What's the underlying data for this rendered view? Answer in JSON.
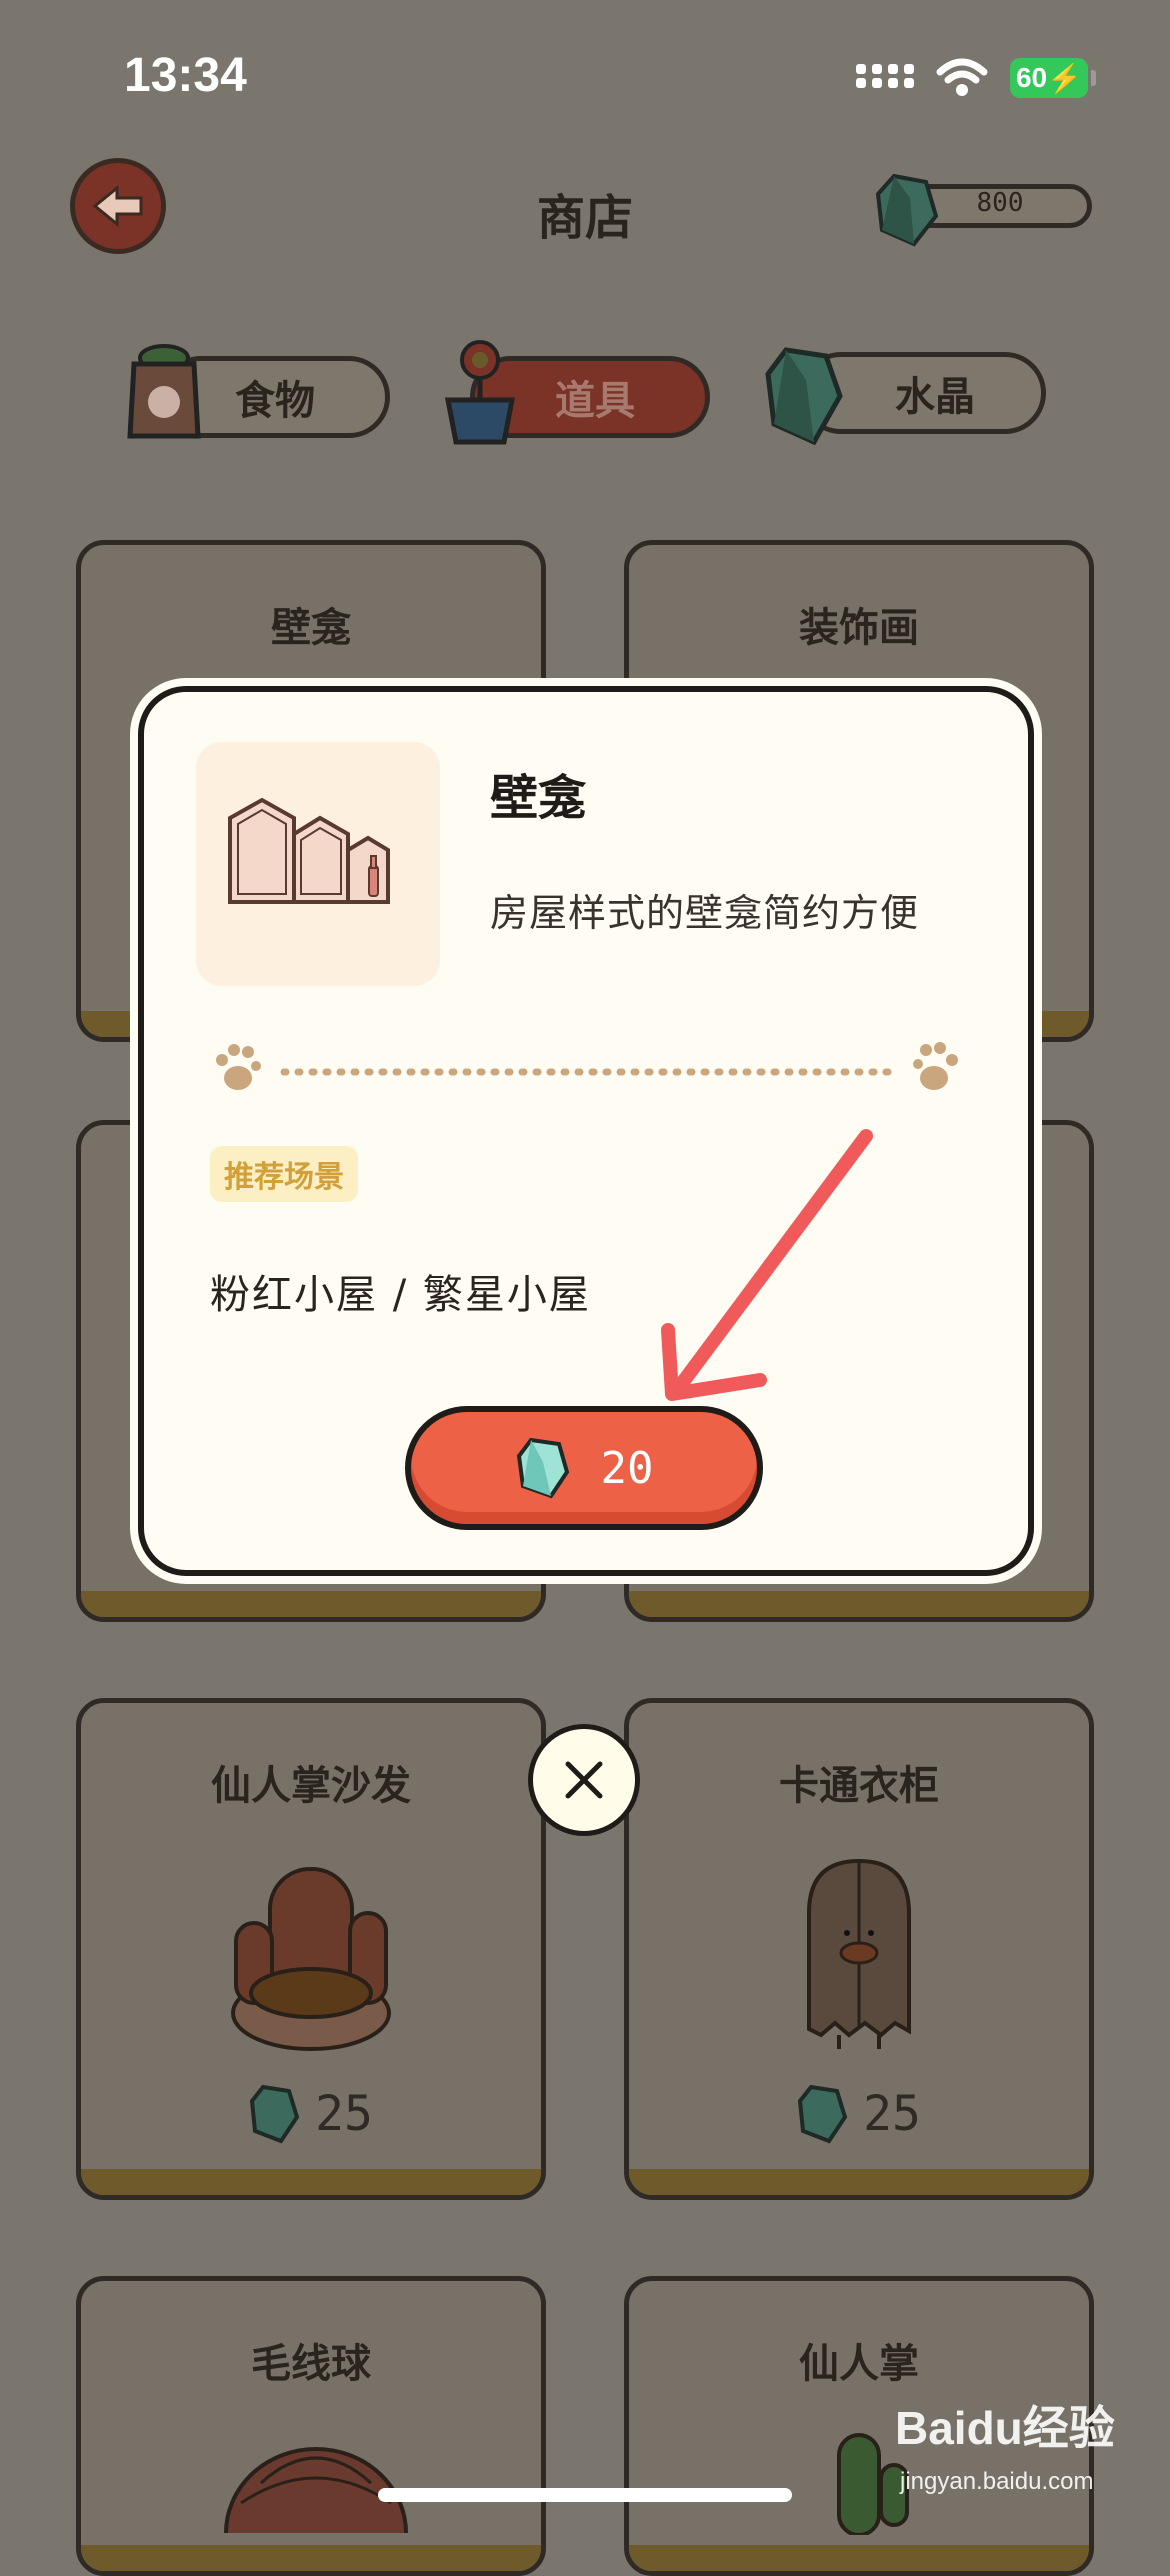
{
  "status_bar": {
    "time": "13:34",
    "battery": "60"
  },
  "header": {
    "title": "商店",
    "balance": "800"
  },
  "tabs": [
    {
      "label": "食物",
      "active": false
    },
    {
      "label": "道具",
      "active": true
    },
    {
      "label": "水晶",
      "active": false
    }
  ],
  "cards": [
    {
      "name": "壁龛"
    },
    {
      "name": "装饰画"
    },
    {
      "name": "仙人掌沙发",
      "price": "25"
    },
    {
      "name": "卡通衣柜",
      "price": "25"
    },
    {
      "name": "毛线球"
    },
    {
      "name": "仙人掌"
    }
  ],
  "modal": {
    "title": "壁龛",
    "description": "房屋样式的壁龛简约方便",
    "scene_tag": "推荐场景",
    "scenes": "粉红小屋 / 繁星小屋",
    "price": "20"
  },
  "watermark": {
    "brand": "Baidu经验",
    "url": "jingyan.baidu.com"
  },
  "colors": {
    "accent": "#ed6147",
    "tag_bg": "#fdefc4",
    "tag_text": "#d2a03b",
    "modal_bg": "#fffcf4"
  }
}
